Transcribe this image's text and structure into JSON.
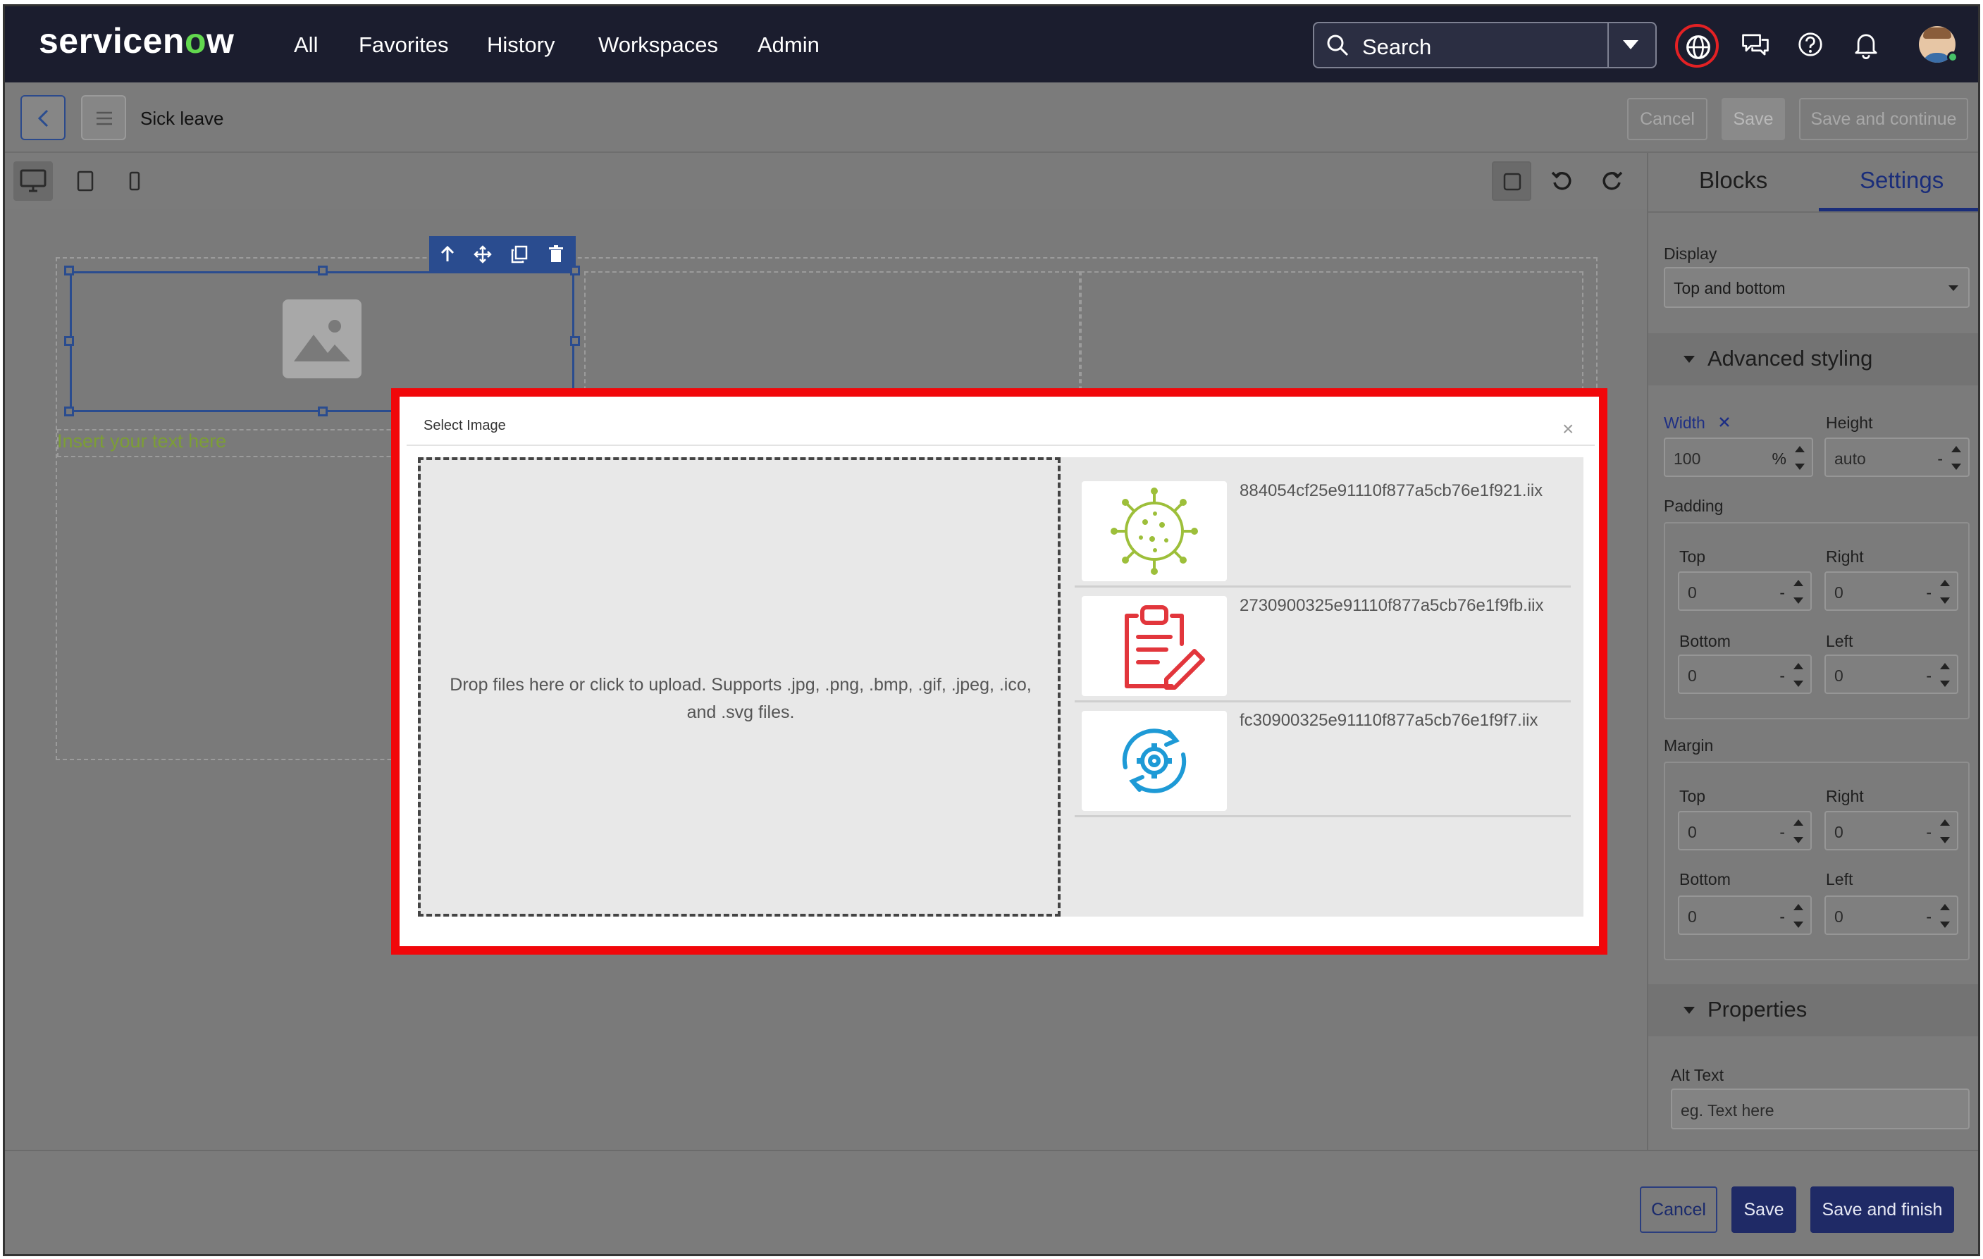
{
  "brand": {
    "name_pre": "servicen",
    "name_o": "o",
    "name_post": "w"
  },
  "nav": {
    "links": [
      "All",
      "Favorites",
      "History",
      "Workspaces",
      "Admin"
    ],
    "search_label": "Search",
    "icons": [
      "globe-icon",
      "chat-icon",
      "help-icon",
      "bell-icon",
      "user-avatar"
    ]
  },
  "header": {
    "title": "Sick leave",
    "cancel": "Cancel",
    "save": "Save",
    "save_continue": "Save and continue"
  },
  "toolbar": {
    "devices": [
      "desktop-icon",
      "tablet-icon",
      "mobile-icon"
    ],
    "actions": [
      "select-box-icon",
      "undo-icon",
      "redo-icon"
    ]
  },
  "panel": {
    "tabs": [
      "Blocks",
      "Settings"
    ],
    "active_tab": "Settings",
    "display_label": "Display",
    "display_value": "Top and bottom",
    "advanced_styling": "Advanced styling",
    "width_label": "Width",
    "width_value": "100",
    "width_unit": "%",
    "height_label": "Height",
    "height_value": "auto",
    "padding": {
      "label": "Padding",
      "top": "Top",
      "right": "Right",
      "bottom": "Bottom",
      "left": "Left",
      "top_val": "0",
      "right_val": "0",
      "bottom_val": "0",
      "left_val": "0",
      "unit": "-"
    },
    "margin": {
      "label": "Margin",
      "top": "Top",
      "right": "Right",
      "bottom": "Bottom",
      "left": "Left",
      "top_val": "0",
      "right_val": "0",
      "bottom_val": "0",
      "left_val": "0",
      "unit": "-"
    },
    "properties": "Properties",
    "alt_label": "Alt Text",
    "alt_placeholder": "eg. Text here"
  },
  "canvas": {
    "insert_text": "Insert your text here",
    "block_tools": [
      "arrow-up-icon",
      "move-icon",
      "copy-icon",
      "trash-icon"
    ]
  },
  "modal": {
    "title": "Select Image",
    "close": "×",
    "drop_message": "Drop files here or click to upload. Supports .jpg, .png, .bmp, .gif, .jpeg, .ico, and .svg files.",
    "files": [
      {
        "name": "884054cf25e91110f877a5cb76e1f921.iix",
        "icon": "virus-icon"
      },
      {
        "name": "2730900325e91110f877a5cb76e1f9fb.iix",
        "icon": "clipboard-edit-icon"
      },
      {
        "name": "fc30900325e91110f877a5cb76e1f9f7.iix",
        "icon": "gear-refresh-icon"
      }
    ]
  },
  "footer": {
    "cancel": "Cancel",
    "save": "Save",
    "save_finish": "Save and finish"
  },
  "colors": {
    "nav_bg": "#1b1d2e",
    "accent": "#1a2d7a",
    "highlight": "#f1070a",
    "logo_o": "#62d84e",
    "insert_text": "#7c9e35"
  }
}
